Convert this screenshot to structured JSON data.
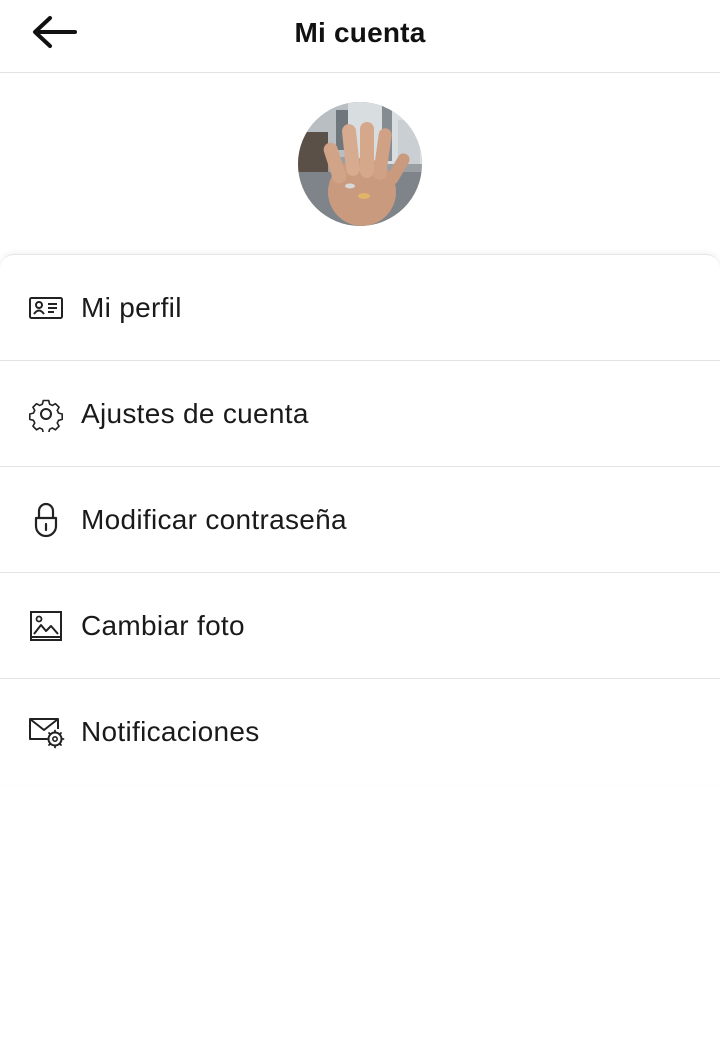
{
  "header": {
    "title": "Mi cuenta",
    "back_icon": "arrow-left-icon"
  },
  "profile": {
    "avatar_icon": "profile-photo"
  },
  "menu": {
    "items": [
      {
        "label": "Mi perfil",
        "icon": "id-card-icon"
      },
      {
        "label": "Ajustes de cuenta",
        "icon": "gear-icon"
      },
      {
        "label": "Modificar contraseña",
        "icon": "lock-icon"
      },
      {
        "label": "Cambiar foto",
        "icon": "image-icon"
      },
      {
        "label": "Notificaciones",
        "icon": "mail-settings-icon"
      }
    ]
  }
}
